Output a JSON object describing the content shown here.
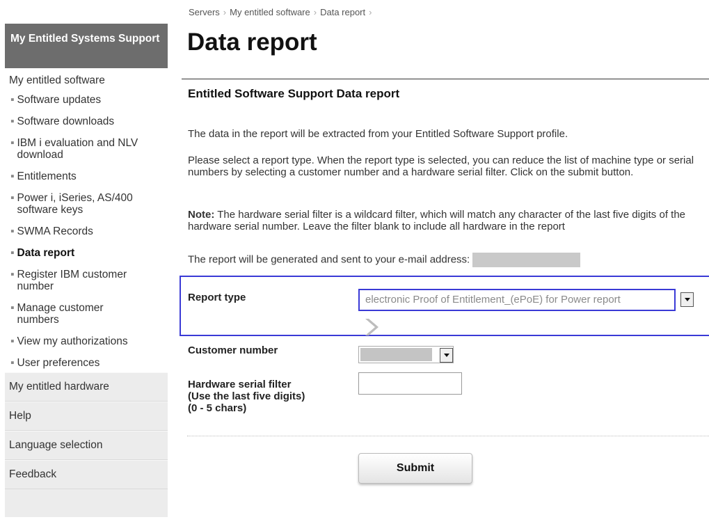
{
  "breadcrumb": [
    "Servers",
    "My entitled software",
    "Data report"
  ],
  "page_title": "Data report",
  "sidebar": {
    "header": "My Entitled Systems Support",
    "section_title": "My entitled software",
    "items": [
      {
        "label": "Software updates"
      },
      {
        "label": "Software downloads"
      },
      {
        "label": "IBM i evaluation and NLV download"
      },
      {
        "label": "Entitlements"
      },
      {
        "label": "Power i, iSeries, AS/400 software keys"
      },
      {
        "label": "SWMA Records"
      },
      {
        "label": "Data report",
        "active": true
      },
      {
        "label": "Register IBM customer number"
      },
      {
        "label": "Manage customer numbers"
      },
      {
        "label": "View my authorizations"
      },
      {
        "label": "User preferences"
      }
    ],
    "sections": [
      "My entitled hardware",
      "Help",
      "Language selection",
      "Feedback"
    ]
  },
  "main": {
    "section_title": "Entitled Software Support Data report",
    "para1": "The data in the report will be extracted from your Entitled Software Support profile.",
    "para2": "Please select a report type. When the report type is selected, you can reduce the list of machine type or serial numbers by selecting a customer number and a hardware serial filter. Click on the submit button.",
    "note_label": "Note:",
    "note_text": " The hardware serial filter is a wildcard filter, which will match any character of the last five digits of the hardware serial number. Leave the filter blank to include all hardware in the report",
    "email_text": "The report will be generated and sent to your e-mail address:"
  },
  "form": {
    "report_type_label": "Report type",
    "report_type_value": "electronic Proof of Entitlement_(ePoE) for Power report",
    "customer_number_label": "Customer number",
    "hw_filter_label": "Hardware serial filter",
    "hw_filter_hint": "(Use the last five digits)",
    "hw_filter_chars": "(0 - 5 chars)",
    "submit_label": "Submit"
  },
  "colors": {
    "sidebar_header_bg": "#6d6d6d",
    "sidebar_gray_bg": "#ececec",
    "focus_outline": "#3a3ad6"
  }
}
